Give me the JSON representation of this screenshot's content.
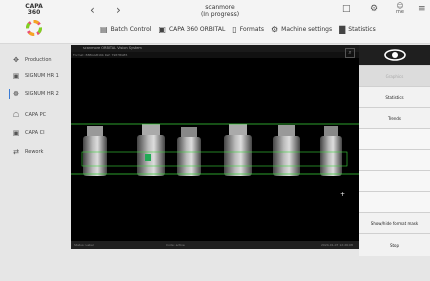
{
  "app": {
    "logo_line1": "CAPA",
    "logo_line2": "360"
  },
  "status": {
    "title": "scanmore",
    "subtitle": "(In progress)"
  },
  "user": {
    "label": "me"
  },
  "toolbar": {
    "items": [
      {
        "label": "Batch Control",
        "icon": "batch-icon"
      },
      {
        "label": "CAPA 360 ORBITAL",
        "icon": "orbital-icon"
      },
      {
        "label": "Formats",
        "icon": "formats-icon"
      },
      {
        "label": "Machine settings",
        "icon": "machine-settings-icon"
      },
      {
        "label": "Statistics",
        "icon": "statistics-icon"
      }
    ]
  },
  "sidebar": {
    "items": [
      {
        "label": "Production",
        "icon": "production-icon"
      },
      {
        "label": "SIGNUM HR 1",
        "icon": "camera-icon"
      },
      {
        "label": "SIGNUM HR 2",
        "icon": "camera-icon",
        "active": true
      },
      {
        "label": "CAPA PC",
        "icon": "pc-icon"
      },
      {
        "label": "CAPA CI",
        "icon": "ci-icon"
      },
      {
        "label": "Rework",
        "icon": "rework-icon"
      }
    ]
  },
  "camera": {
    "title": "scanmore ORBITAL Vision System",
    "info": "Format: 88BGGB16b   Ref: 7987BGB5",
    "footer_status": "Status: Label",
    "footer_code": "Code: active",
    "footer_time": "2024-01-07 12:26:08"
  },
  "right_panel": {
    "buttons": [
      "Graphics",
      "Statistics",
      "Trends",
      "",
      "",
      "",
      "",
      "Show/hide format mask",
      "Stop"
    ]
  },
  "colors": {
    "accent": "#3a7bd5",
    "roi": "#3cd43c"
  }
}
